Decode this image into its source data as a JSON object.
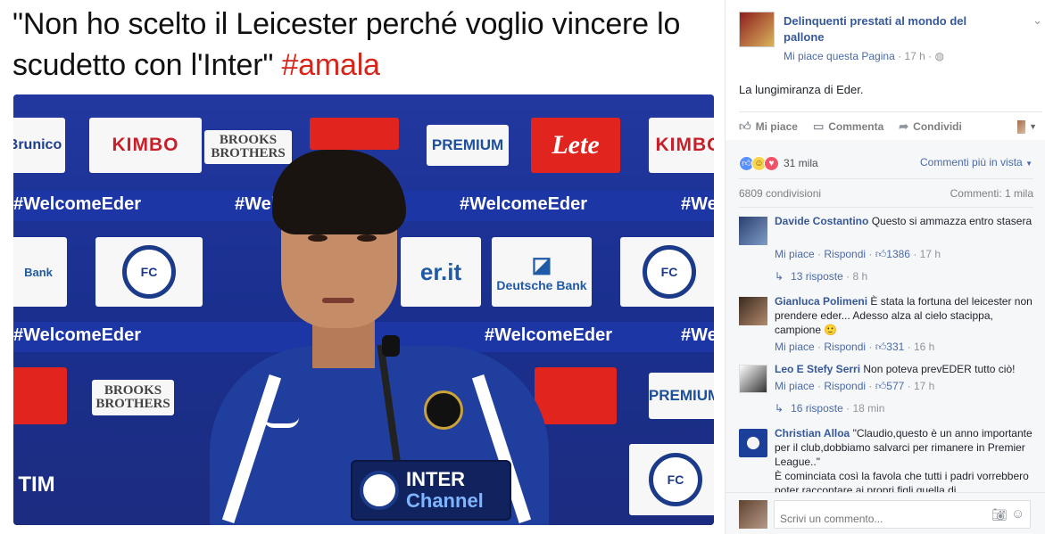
{
  "meme": {
    "caption": "\"Non ho scelto il Leicester perché voglio vincere lo scudetto con l'Inter\"",
    "hashtag": "#amala",
    "backdrop": {
      "sponsor_row1": [
        "Brunico",
        "KIMBO",
        "BROOKS BROTHERS",
        "PREMIUM",
        "Lete",
        "KIMBO"
      ],
      "welcome_text": "#WelcomeEder",
      "sponsor_row3": [
        "Deutsche Bank",
        "er.it"
      ],
      "sponsor_row5": [
        "BROOKS BROTHERS",
        "PREMIUM"
      ],
      "bottom_tim": "TIM",
      "channel_line1": "INTER",
      "channel_line2": "Channel"
    }
  },
  "post": {
    "page_name": "Delinquenti prestati al mondo del pallone",
    "meta_like": "Mi piace questa Pagina",
    "meta_time": "17 h",
    "meta_sep": "·",
    "text": "La lungimiranza di Eder.",
    "actions": {
      "like": "Mi piace",
      "comment": "Commenta",
      "share": "Condividi"
    },
    "reactions_count": "31 mila",
    "relevance": "Commenti più in vista",
    "shares": "6809 condivisioni",
    "comments_count": "Commenti: 1 mila"
  },
  "comments": [
    {
      "name": "Davide Costantino",
      "text": "Questo si ammazza entro stasera",
      "like": "Mi piace",
      "reply": "Rispondi",
      "likes": "1386",
      "time": "17 h",
      "replies": "13 risposte",
      "replies_time": "8 h"
    },
    {
      "name": "Gianluca Polimeni",
      "text": "È stata la fortuna del leicester non prendere eder... Adesso alza al cielo stacippa, campione 🙂",
      "like": "Mi piace",
      "reply": "Rispondi",
      "likes": "331",
      "time": "16 h"
    },
    {
      "name": "Leo E Stefy Serri",
      "text": "Non poteva prevEDER tutto ciò!",
      "like": "Mi piace",
      "reply": "Rispondi",
      "likes": "577",
      "time": "17 h",
      "replies": "16 risposte",
      "replies_time": "18 min"
    },
    {
      "name": "Christian Alloa",
      "text": "\"Claudio,questo è un anno importante per il club,dobbiamo salvarci per rimanere in Premier League..\"",
      "text2": "È cominciata così la favola che tutti i padri vorrebbero poter raccontare ai propri figli quella di"
    }
  ],
  "composer": {
    "placeholder": "Scrivi un commento..."
  },
  "icons": {
    "globe": "globe-icon",
    "chevron": "chevron-down-icon",
    "like": "thumbs-up-icon",
    "comment": "comment-icon",
    "share": "share-icon",
    "camera": "camera-icon",
    "emoji": "emoji-icon"
  },
  "colors": {
    "link_blue": "#365899",
    "hashtag_red": "#d8241b",
    "panel_gray": "#f6f7f9"
  }
}
